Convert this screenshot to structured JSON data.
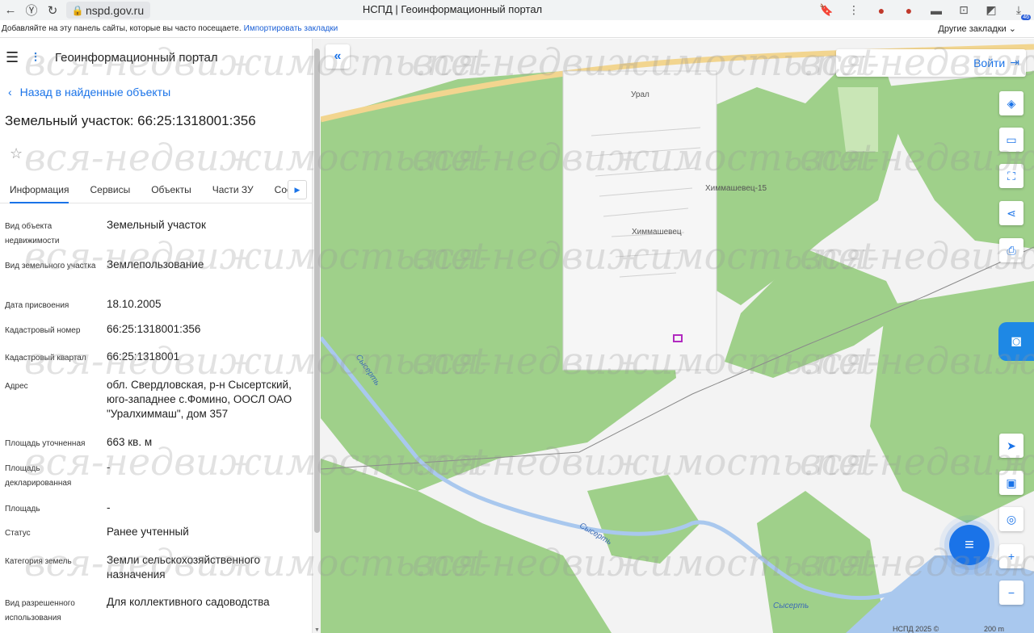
{
  "browser": {
    "url": "nspd.gov.ru",
    "tab_title": "НСПД | Геоинформационный портал",
    "bookmarks_hint": "Добавляйте на эту панель сайты, которые вы часто посещаете.",
    "import_link": "Импортировать закладки",
    "other_bookmarks": "Другие закладки",
    "download_badge": "46"
  },
  "portal": {
    "title": "Геоинформационный портал",
    "back_link": "Назад в найденные объекты",
    "object_title": "Земельный участок: 66:25:1318001:356",
    "tabs": [
      "Информация",
      "Сервисы",
      "Объекты",
      "Части ЗУ",
      "Соста"
    ],
    "active_tab": "Информация"
  },
  "properties": [
    {
      "label": "Вид объекта недвижимости",
      "value": "Земельный участок"
    },
    {
      "label": "Вид земельного участка",
      "value": "Землепользование"
    },
    {
      "label": "Дата присвоения",
      "value": "18.10.2005"
    },
    {
      "label": "Кадастровый номер",
      "value": "66:25:1318001:356"
    },
    {
      "label": "Кадастровый квартал",
      "value": "66:25:1318001"
    },
    {
      "label": "Адрес",
      "value": "обл. Свердловская, р-н Сысертский, юго-западнее с.Фомино, ООСЛ ОАО \"Уралхиммаш\", дом 357"
    },
    {
      "label": "Площадь уточненная",
      "value": "663 кв. м"
    },
    {
      "label": "Площадь декларированная",
      "value": "-"
    },
    {
      "label": "Площадь",
      "value": "-"
    },
    {
      "label": "Статус",
      "value": "Ранее учтенный"
    },
    {
      "label": "Категория земель",
      "value": "Земли сельскохозяйственного назначения"
    },
    {
      "label": "Вид разрешенного использования",
      "value": "Для коллективного садоводства"
    }
  ],
  "map": {
    "login": "Войти",
    "labels": {
      "ural": "Урал",
      "himmashevets15": "Химмашевец-15",
      "himmashevets": "Химмашевец",
      "river1": "Сысерть",
      "river2": "Сысерть",
      "river3": "Сысерть"
    },
    "copyright": "НСПД 2025 ©",
    "scale": "200 m",
    "colors": {
      "forest": "#9fd08a",
      "field": "#f3f3f3",
      "road": "#f2d58f",
      "water": "#a9c8ee",
      "accent": "#1a73e8"
    }
  },
  "watermark": "вся-недвижимость.net"
}
